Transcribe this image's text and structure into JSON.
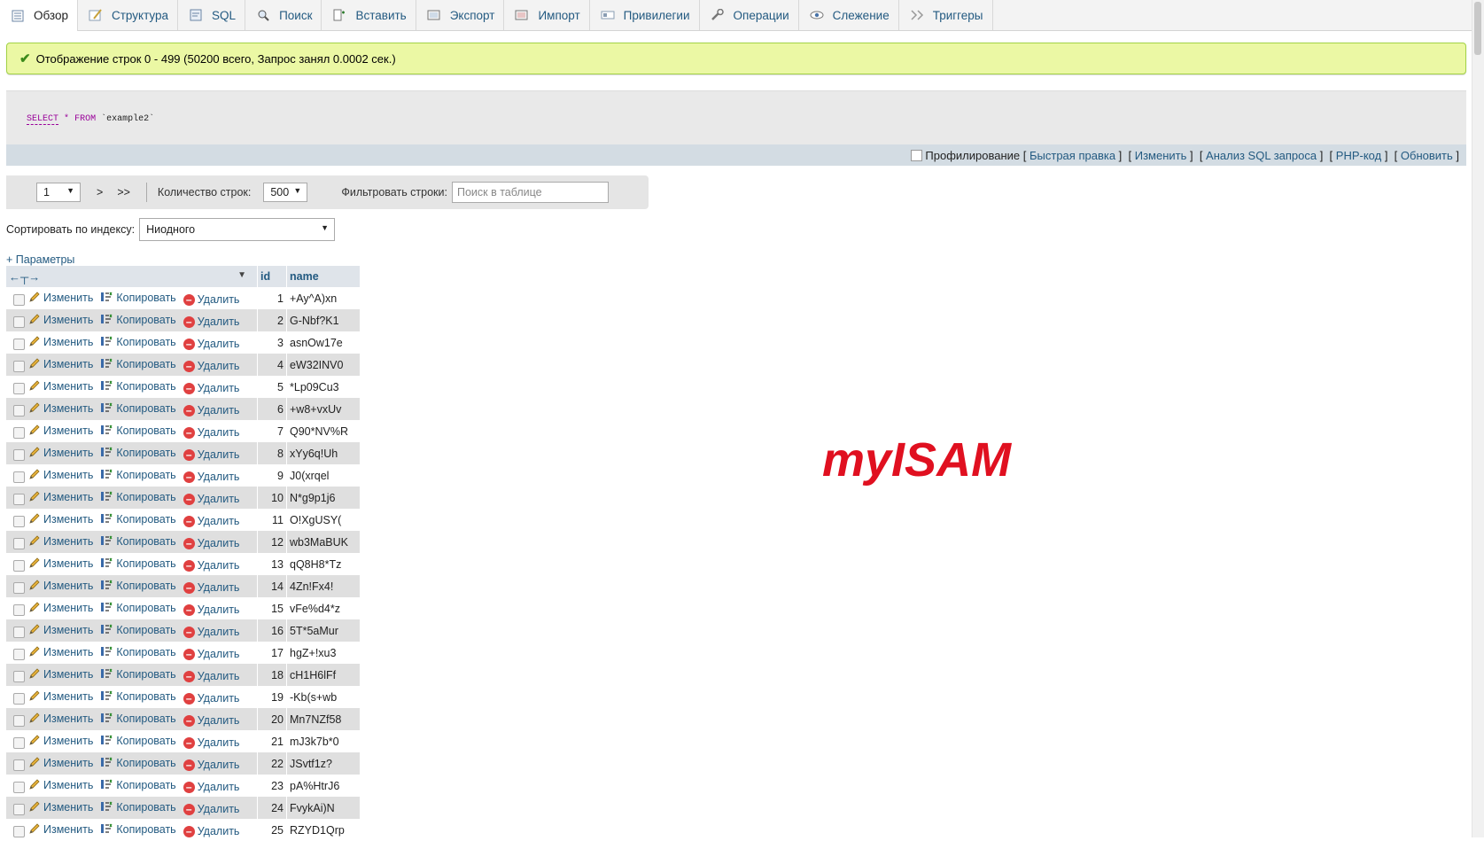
{
  "tabs": [
    {
      "label": "Обзор",
      "icon": "browse-icon",
      "active": true
    },
    {
      "label": "Структура",
      "icon": "structure-icon"
    },
    {
      "label": "SQL",
      "icon": "sql-icon"
    },
    {
      "label": "Поиск",
      "icon": "search-icon"
    },
    {
      "label": "Вставить",
      "icon": "insert-icon"
    },
    {
      "label": "Экспорт",
      "icon": "export-icon"
    },
    {
      "label": "Импорт",
      "icon": "import-icon"
    },
    {
      "label": "Привилегии",
      "icon": "privileges-icon"
    },
    {
      "label": "Операции",
      "icon": "operations-icon"
    },
    {
      "label": "Слежение",
      "icon": "tracking-icon"
    },
    {
      "label": "Триггеры",
      "icon": "triggers-icon"
    }
  ],
  "message": "Отображение строк 0 - 499 (50200 всего, Запрос занял 0.0002 сек.)",
  "sql": {
    "kw1": "SELECT",
    "star": "*",
    "kw2": "FROM",
    "table": "`example2`"
  },
  "query_ops": {
    "profiling": "Профилирование",
    "links": [
      "Быстрая правка",
      "Изменить",
      "Анализ SQL запроса",
      "PHP-код",
      "Обновить"
    ]
  },
  "navigation": {
    "page": "1",
    "next": ">",
    "last": ">>",
    "rows_label": "Количество строк:",
    "rows_value": "500",
    "filter_label": "Фильтровать строки:",
    "filter_placeholder": "Поиск в таблице"
  },
  "sort": {
    "label": "Сортировать по индексу:",
    "value": "Ниодного"
  },
  "options_link": "+ Параметры",
  "table": {
    "columns": [
      "id",
      "name"
    ],
    "actions": {
      "edit": "Изменить",
      "copy": "Копировать",
      "delete": "Удалить"
    },
    "rows": [
      {
        "id": "1",
        "name": "+Ay^A)xn"
      },
      {
        "id": "2",
        "name": "G-Nbf?K1"
      },
      {
        "id": "3",
        "name": "asnOw17e"
      },
      {
        "id": "4",
        "name": "eW32INV0"
      },
      {
        "id": "5",
        "name": "*Lp09Cu3"
      },
      {
        "id": "6",
        "name": "+w8+vxUv"
      },
      {
        "id": "7",
        "name": "Q90*NV%R"
      },
      {
        "id": "8",
        "name": "xYy6q!Uh"
      },
      {
        "id": "9",
        "name": "J0(xrqel"
      },
      {
        "id": "10",
        "name": "N*g9p1j6"
      },
      {
        "id": "11",
        "name": "O!XgUSY("
      },
      {
        "id": "12",
        "name": "wb3MaBUK"
      },
      {
        "id": "13",
        "name": "qQ8H8*Tz"
      },
      {
        "id": "14",
        "name": "4Zn!Fx4!"
      },
      {
        "id": "15",
        "name": "vFe%d4*z"
      },
      {
        "id": "16",
        "name": "5T*5aMur"
      },
      {
        "id": "17",
        "name": "hgZ+!xu3"
      },
      {
        "id": "18",
        "name": "cH1H6lFf"
      },
      {
        "id": "19",
        "name": "-Kb(s+wb"
      },
      {
        "id": "20",
        "name": "Mn7NZf58"
      },
      {
        "id": "21",
        "name": "mJ3k7b*0"
      },
      {
        "id": "22",
        "name": "JSvtf1z?"
      },
      {
        "id": "23",
        "name": "pA%HtrJ6"
      },
      {
        "id": "24",
        "name": "FvykAi)N"
      },
      {
        "id": "25",
        "name": "RZYD1Qrp"
      }
    ]
  },
  "overlay_text": "myISAM"
}
